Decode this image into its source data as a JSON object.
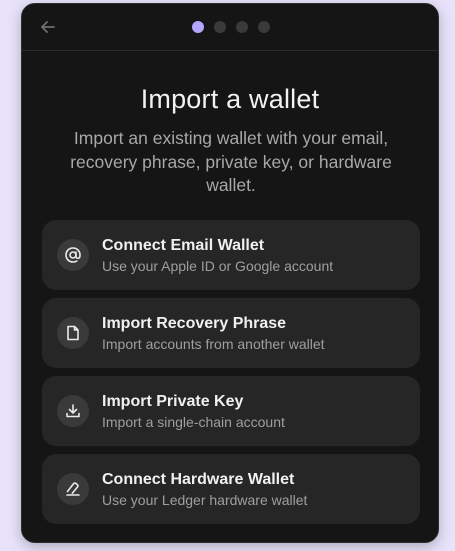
{
  "header": {
    "back_icon": "arrow-left-icon",
    "steps_total": 4,
    "step_active": 1
  },
  "title": "Import a wallet",
  "subtitle": "Import an existing wallet with your email, recovery phrase, private key, or hardware wallet.",
  "options": [
    {
      "icon": "at-sign-icon",
      "title": "Connect Email Wallet",
      "description": "Use your Apple ID or Google account"
    },
    {
      "icon": "document-icon",
      "title": "Import Recovery Phrase",
      "description": "Import accounts from another wallet"
    },
    {
      "icon": "download-icon",
      "title": "Import Private Key",
      "description": "Import a single-chain account"
    },
    {
      "icon": "hardware-wallet-icon",
      "title": "Connect Hardware Wallet",
      "description": "Use your Ledger hardware wallet"
    }
  ],
  "colors": {
    "page_background": "#e8e3fb",
    "modal_background": "#151515",
    "card_background": "#262626",
    "active_step_dot": "#b4a6ff",
    "inactive_step_dot": "#3a3a3a"
  }
}
